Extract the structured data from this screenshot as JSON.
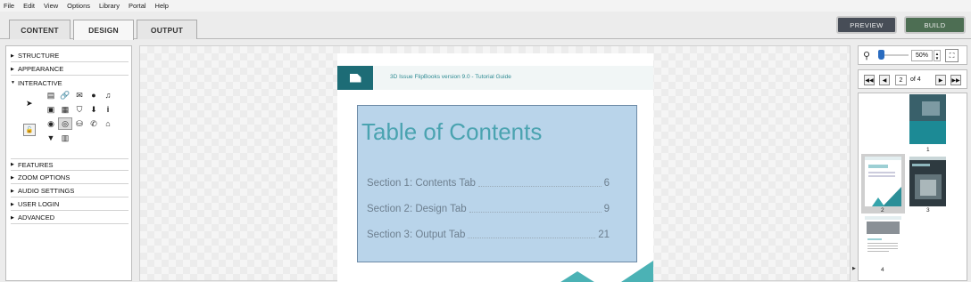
{
  "menubar": {
    "items": [
      "File",
      "Edit",
      "View",
      "Options",
      "Library",
      "Portal",
      "Help"
    ]
  },
  "tabs": [
    {
      "label": "CONTENT",
      "active": false
    },
    {
      "label": "DESIGN",
      "active": true
    },
    {
      "label": "OUTPUT",
      "active": false
    }
  ],
  "header_buttons": {
    "preview": "PREVIEW",
    "build": "BUILD"
  },
  "design_sections": [
    {
      "label": "STRUCTURE",
      "expanded": false
    },
    {
      "label": "APPEARANCE",
      "expanded": false
    },
    {
      "label": "INTERACTIVE",
      "expanded": true
    },
    {
      "label": "FEATURES",
      "expanded": false
    },
    {
      "label": "ZOOM OPTIONS",
      "expanded": false
    },
    {
      "label": "AUDIO SETTINGS",
      "expanded": false
    },
    {
      "label": "USER LOGIN",
      "expanded": false
    },
    {
      "label": "ADVANCED",
      "expanded": false
    }
  ],
  "interactive_tools": [
    [
      "page-icon",
      "link-icon",
      "email-icon",
      "speech-bubble-icon",
      "music-note-icon"
    ],
    [
      "image-icon",
      "film-icon",
      "html5-icon",
      "download-icon",
      "info-icon"
    ],
    [
      "youtube-icon",
      "vimeo-icon",
      "database-icon",
      "phone-icon",
      "shop-icon"
    ],
    [
      "comment-icon",
      "slideshow-icon"
    ]
  ],
  "document_page": {
    "header_title": "3D Issue FlipBooks version 9.0 - Tutorial Guide",
    "toc_heading": "Table of Contents",
    "toc_entries": [
      {
        "label": "Section 1: Contents Tab",
        "page": "6"
      },
      {
        "label": "Section 2: Design Tab",
        "page": "9"
      },
      {
        "label": "Section 3: Output Tab",
        "page": "21"
      }
    ],
    "accent_color": "#4bb2b5"
  },
  "zoom": {
    "value": "50%",
    "level": 0.0
  },
  "page_nav": {
    "current": "2",
    "of_label": "of",
    "total": "4"
  },
  "thumbnails": [
    {
      "label": "1"
    },
    {
      "label": "2"
    },
    {
      "label": "3"
    },
    {
      "label": "4"
    }
  ]
}
